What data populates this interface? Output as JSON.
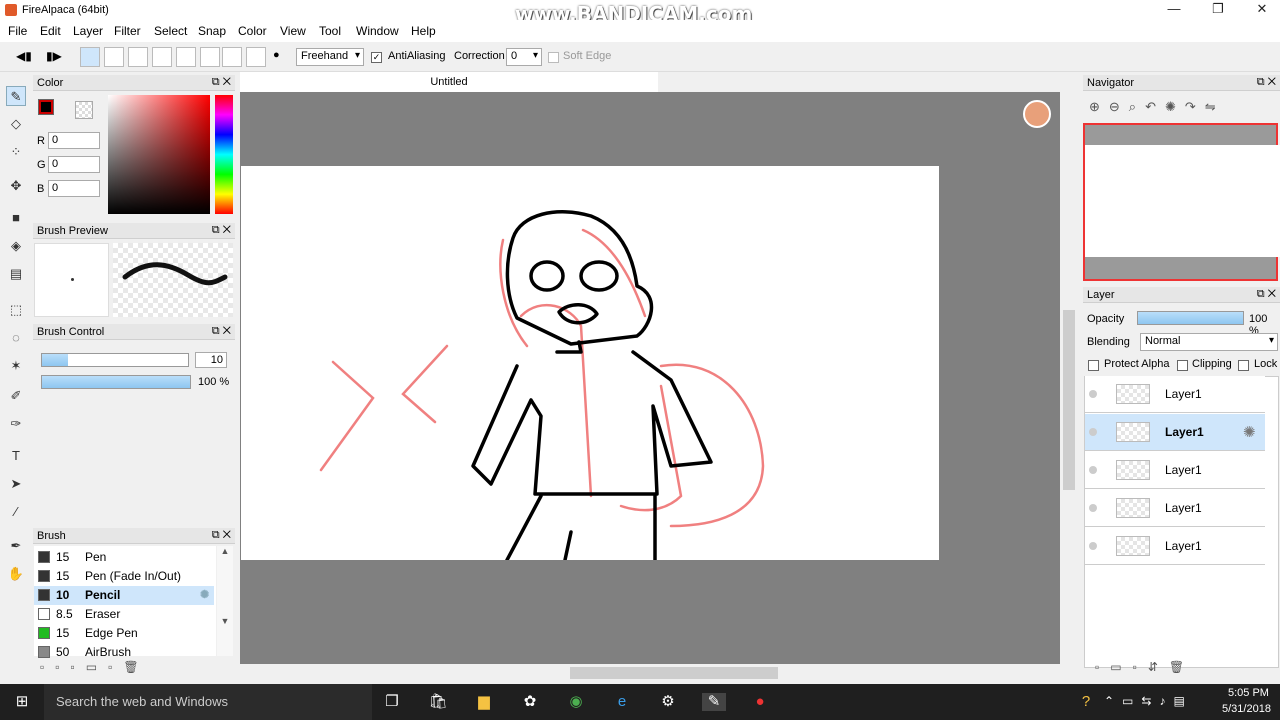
{
  "window": {
    "title": "FireAlpaca (64bit)",
    "watermark": "www.BANDICAM.com",
    "min": "—",
    "max": "❐",
    "close": "✕"
  },
  "menu": [
    "File",
    "Edit",
    "Layer",
    "Filter",
    "Select",
    "Snap",
    "Color",
    "View",
    "Tool",
    "Window",
    "Help"
  ],
  "toolbar": {
    "mode": "Freehand",
    "antialiasing_label": "AntiAliasing",
    "correction_label": "Correction",
    "correction_value": "0",
    "soft_edge_label": "Soft Edge"
  },
  "color_panel": {
    "title": "Color",
    "r_label": "R",
    "r": "0",
    "g_label": "G",
    "g": "0",
    "b_label": "B",
    "b": "0",
    "primary": "#000000"
  },
  "brush_preview": {
    "title": "Brush Preview"
  },
  "brush_control": {
    "title": "Brush Control",
    "size": "10",
    "opacity": "100 %",
    "size_fraction": 0.1,
    "opacity_fraction": 1.0
  },
  "brush_panel": {
    "title": "Brush",
    "items": [
      {
        "size": "15",
        "name": "Pen",
        "color": "#333333"
      },
      {
        "size": "15",
        "name": "Pen (Fade In/Out)",
        "color": "#333333"
      },
      {
        "size": "10",
        "name": "Pencil",
        "color": "#333333",
        "selected": true
      },
      {
        "size": "8.5",
        "name": "Eraser",
        "color": "#ffffff"
      },
      {
        "size": "15",
        "name": "Edge Pen",
        "color": "#22bb22"
      },
      {
        "size": "50",
        "name": "AirBrush",
        "color": "#888888"
      }
    ]
  },
  "document": {
    "tab": "Untitled"
  },
  "navigator": {
    "title": "Navigator"
  },
  "layer_panel": {
    "title": "Layer",
    "opacity_label": "Opacity",
    "opacity_value": "100 %",
    "opacity_fraction": 1.0,
    "blending_label": "Blending",
    "blending_value": "Normal",
    "protect_alpha": "Protect Alpha",
    "clipping": "Clipping",
    "lock": "Lock",
    "layers": [
      {
        "name": "Layer1"
      },
      {
        "name": "Layer1",
        "selected": true
      },
      {
        "name": "Layer1"
      },
      {
        "name": "Layer1"
      },
      {
        "name": "Layer1"
      }
    ]
  },
  "taskbar": {
    "search": "Search the web and Windows",
    "time": "5:05 PM",
    "date": "5/31/2018"
  }
}
